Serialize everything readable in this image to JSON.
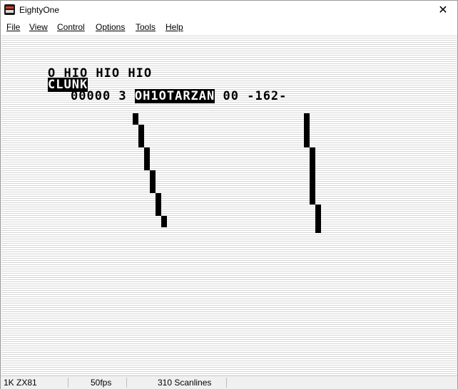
{
  "window": {
    "title": "EightyOne"
  },
  "menu": [
    "File",
    "View",
    "Control",
    "Options",
    "Tools",
    "Help"
  ],
  "screen": {
    "row1": "O HIO HIO HIO",
    "row2": "CLUNK",
    "row3_score": "00000 3",
    "row3_name": "OH1OTARZAN",
    "row3_rest": "00 -162-"
  },
  "status": {
    "model": "1K ZX81",
    "fps": "50fps",
    "scanlines": "310 Scanlines"
  },
  "icons": {
    "app": "eightyone-app-icon",
    "close": "close-icon"
  }
}
